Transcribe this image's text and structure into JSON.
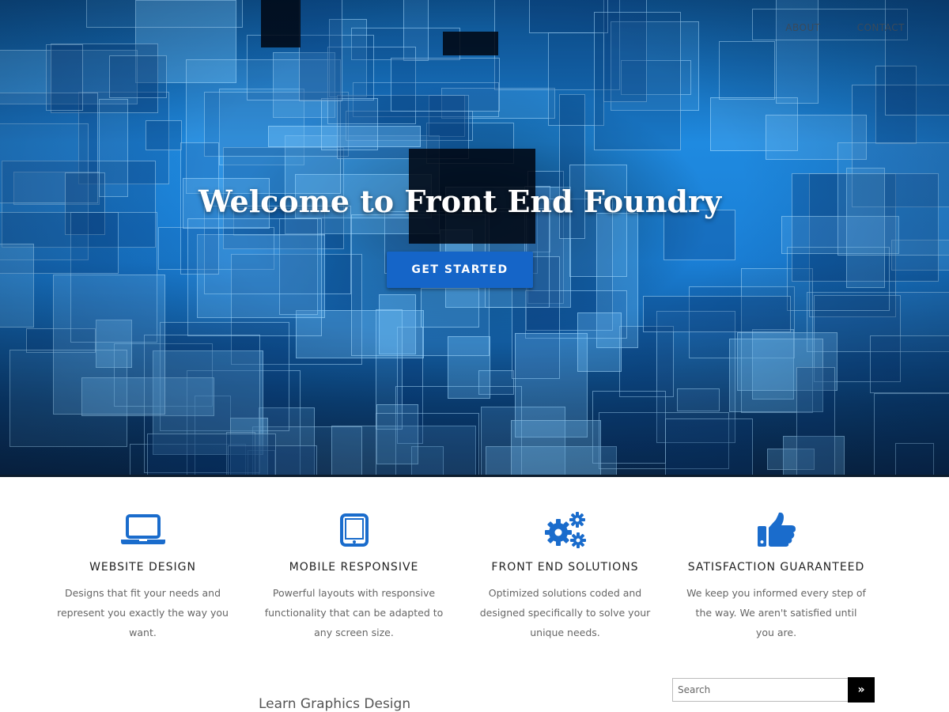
{
  "nav": {
    "items": [
      {
        "label": "ABOUT"
      },
      {
        "label": "CONTACT"
      }
    ]
  },
  "hero": {
    "title": "Welcome to Front End Foundry",
    "cta_label": "GET STARTED"
  },
  "features": [
    {
      "icon": "laptop-icon",
      "title": "WEBSITE DESIGN",
      "text": "Designs that fit your needs and represent you exactly the way you want."
    },
    {
      "icon": "tablet-icon",
      "title": "MOBILE RESPONSIVE",
      "text": "Powerful layouts with responsive functionality that can be adapted to any screen size."
    },
    {
      "icon": "gears-icon",
      "title": "FRONT END SOLUTIONS",
      "text": "Optimized solutions coded and designed specifically to solve your unique needs."
    },
    {
      "icon": "thumbs-up-icon",
      "title": "SATISFACTION GUARANTEED",
      "text": "We keep you informed every step of the way. We aren't satisfied until you are."
    }
  ],
  "bottom": {
    "heading": "Learn Graphics Design"
  },
  "search": {
    "placeholder": "Search",
    "button_label": "»"
  },
  "colors": {
    "accent": "#1565c8",
    "icon": "#1a6ccc",
    "hero_blue": "#1f8ae0"
  }
}
